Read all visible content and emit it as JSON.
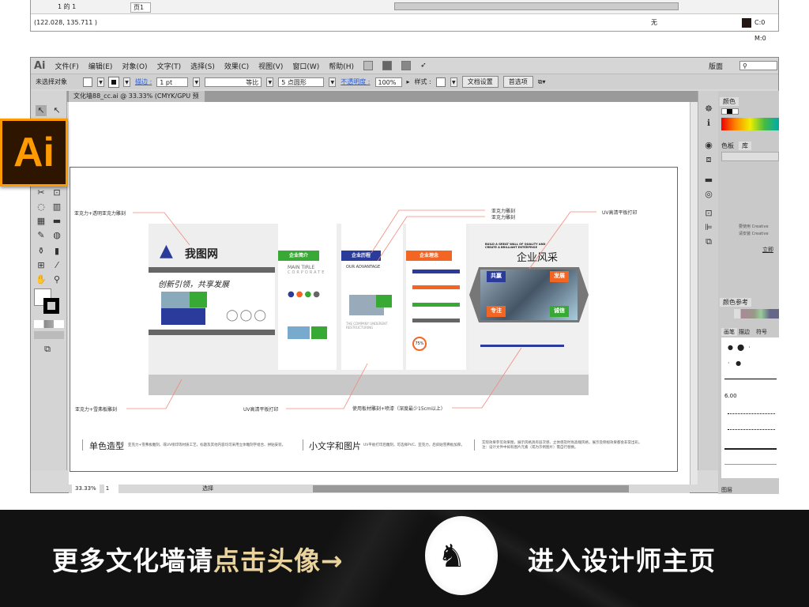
{
  "prev_window": {
    "page_nav": "1 的 1",
    "page_tab": "页1",
    "coords": "(122.028, 135.711 )",
    "fill_none": "无",
    "color_readout": "C:0 M:0"
  },
  "menubar": {
    "logo": "Ai",
    "items": [
      "文件(F)",
      "编辑(E)",
      "对象(O)",
      "文字(T)",
      "选择(S)",
      "效果(C)",
      "视图(V)",
      "窗口(W)",
      "帮助(H)"
    ],
    "workspace": "版面"
  },
  "controlbar": {
    "selection": "未选择对象",
    "stroke_label": "描边 :",
    "stroke_value": "1 pt",
    "profile": "等比",
    "brush": "5 点圆形",
    "opacity_label": "不透明度 :",
    "opacity_value": "100%",
    "style_label": "样式 :",
    "doc_setup": "文档设置",
    "preferences": "首选项"
  },
  "document": {
    "tab_title": "文化墙88_cc.ai @ 33.33% (CMYK/GPU 预览)",
    "close": "×"
  },
  "status": {
    "zoom": "33.33%",
    "artboard": "1",
    "tool": "选择"
  },
  "panels": {
    "color_tab": "颜色",
    "swatches_tab": "色板",
    "library_tab": "库",
    "library_msg1": "要使用 Creative",
    "library_msg2": "请安装 Creative",
    "library_link": "立即",
    "color_guide_tab": "颜色参考",
    "brushes_tab": "画笔",
    "stroke_tab": "描边",
    "symbols_tab": "符号",
    "brush_size": "6.00",
    "layers_tab": "图层"
  },
  "ai_logo": "Ai",
  "artwork": {
    "logo_text": "我图网",
    "slogan": "创新引领，共享发展",
    "p1_header": "企业简介",
    "p1_title": "MAIN TIRLE",
    "p1_sub": "CORPORATE",
    "p2_header": "企业历程",
    "p2_title": "OUR ADVANTAGE",
    "p2_sub": "THE COMPANY UNDERENT RESTRUCTURING",
    "p3_header": "企业理念",
    "p3_percent": "75%",
    "p4_sub": "BUILD A GREAT WALL OF QUALITY AND CREATE A BRILLIANT ENTERPRISE",
    "p4_title": "企业风采",
    "values": [
      "共赢",
      "发展",
      "专注",
      "诚信"
    ]
  },
  "annotations": [
    "亚克力+透明亚克力雕刻",
    "亚克力+雪弗板雕刻",
    "UV高清平板打印",
    "使用板材雕刻+喷漆（深度最少15cm以上）",
    "亚克力雕刻",
    "亚克力雕刻",
    "UV高清平板打印"
  ],
  "notes": [
    {
      "title": "单色造型",
      "text": "亚克力+雪弗板雕刻，或UV喷印等材质工艺，标题及其他内容均可采用立体雕刻字组合、拼贴安装。"
    },
    {
      "title": "小文字和图片",
      "text": "UV平板打印后雕刻，可选择PVC、亚克力，后斜贴雪弗板加厚。"
    },
    {
      "title": "",
      "text": "实际效果参见效果图，展示风格具有层次感、立体感及时尚高端风格，展示及侧视效果都会非常出彩。",
      "text2": "注：设计文件中如有图片元素（或为示例图片）需自行替换。"
    }
  ],
  "banner": {
    "part1": "更多文化墙请",
    "part2": "点击头像→",
    "part3": "进入设计师主页",
    "accent": "#e9d39a"
  }
}
